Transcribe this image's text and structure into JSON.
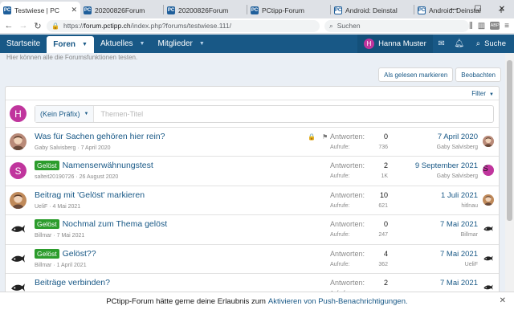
{
  "browser": {
    "tabs": [
      {
        "label": "Testwiese | PC",
        "icon": "pc-favicon",
        "active": true
      },
      {
        "label": "20200826Forum",
        "icon": "pc-favicon"
      },
      {
        "label": "20200826Forum",
        "icon": "pc-favicon"
      },
      {
        "label": "PCtipp-Forum",
        "icon": "pc-favicon"
      },
      {
        "label": "Android: Deinstal",
        "icon": "android-favicon"
      },
      {
        "label": "Android: Deinstal",
        "icon": "android-favicon"
      }
    ],
    "url_prefix": "https://",
    "url_domain": "forum.pctipp.ch",
    "url_path": "/index.php?forums/testwiese.111/",
    "search_placeholder": "Suchen",
    "ext_label": "ABP"
  },
  "nav": {
    "items": [
      {
        "label": "Startseite"
      },
      {
        "label": "Foren",
        "active": true
      },
      {
        "label": "Aktuelles"
      },
      {
        "label": "Mitglieder"
      }
    ],
    "user": {
      "name": "Hanna Muster",
      "initial": "H"
    },
    "search_label": "Suche"
  },
  "forum": {
    "description": "Hier können alle die Forumsfunktionen testen.",
    "mark_read": "Als gelesen markieren",
    "watch": "Beobachten",
    "filter": "Filter",
    "prefix_select": "(Kein Präfix)",
    "title_placeholder": "Themen-Titel",
    "new_avatar": "H"
  },
  "labels": {
    "replies": "Antworten:",
    "views": "Aufrufe:"
  },
  "threads": [
    {
      "title": "Was für Sachen gehören hier rein?",
      "badge": "",
      "author": "Gaby Salvisberg",
      "date": "7 April 2020",
      "replies": "0",
      "views": "736",
      "last_date": "7 April 2020",
      "last_user": "Gaby Salvisberg",
      "avatar": "photo",
      "avatar_color": "#b98a78",
      "icons": "🔒 ⚑"
    },
    {
      "title": "Namenserwähnungstest",
      "badge": "Gelöst",
      "author": "salteit20190726",
      "date": "26 August 2020",
      "replies": "2",
      "views": "1K",
      "last_date": "9 September 2021",
      "last_user": "Gaby Salvisberg",
      "avatar": "S",
      "avatar_color": "#c0359d"
    },
    {
      "title": "Beitrag mit 'Gelöst' markieren",
      "badge": "",
      "author": "UeliF",
      "date": "4 Mai 2021",
      "replies": "10",
      "views": "621",
      "last_date": "1 Juli 2021",
      "last_user": "hitlnau",
      "avatar": "photo",
      "avatar_color": "#c08a5a"
    },
    {
      "title": "Nochmal zum Thema gelöst",
      "badge": "Gelöst",
      "author": "Billmar",
      "date": "7 Mai 2021",
      "replies": "0",
      "views": "247",
      "last_date": "7 Mai 2021",
      "last_user": "Billmar",
      "avatar": "fish",
      "avatar_color": "#ffffff"
    },
    {
      "title": "Gelöst??",
      "badge": "Gelöst",
      "author": "Billmar",
      "date": "1 April 2021",
      "replies": "4",
      "views": "362",
      "last_date": "7 Mai 2021",
      "last_user": "UeliF",
      "avatar": "fish",
      "avatar_color": "#ffffff"
    },
    {
      "title": "Beiträge verbinden?",
      "badge": "",
      "author": "",
      "date": "",
      "replies": "2",
      "views": "",
      "last_date": "7 Mai 2021",
      "last_user": "",
      "avatar": "fish",
      "avatar_color": "#ffffff"
    }
  ],
  "notice": {
    "text": "PCtipp-Forum hätte gerne deine Erlaubnis zum",
    "link": "Aktivieren von Push-Benachrichtigungen."
  }
}
